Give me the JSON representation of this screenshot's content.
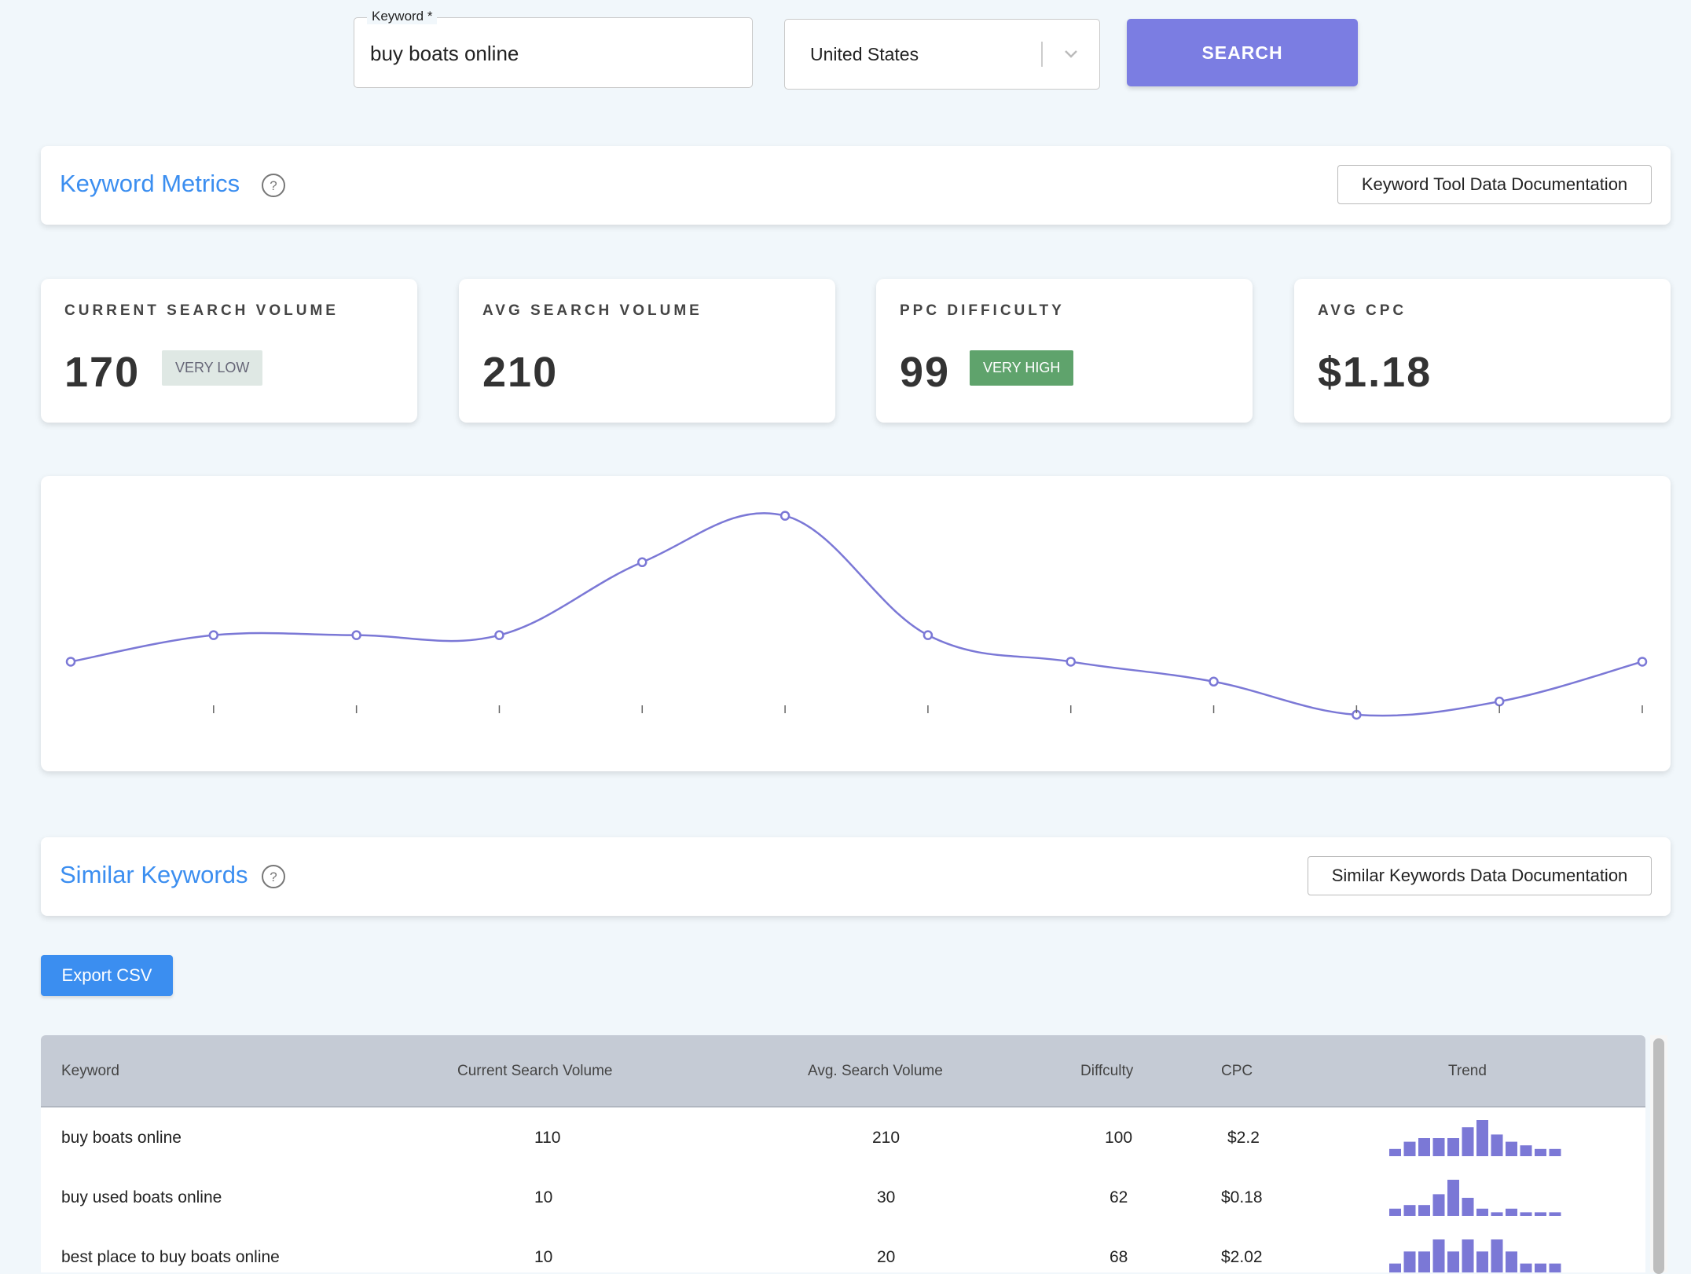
{
  "search": {
    "keyword_label": "Keyword *",
    "keyword_value": "buy boats online",
    "country_value": "United States",
    "search_label": "SEARCH"
  },
  "metrics_section": {
    "title": "Keyword Metrics",
    "doc_button": "Keyword Tool Data Documentation"
  },
  "metrics": [
    {
      "label": "CURRENT SEARCH VOLUME",
      "value": "170",
      "badge": "VERY LOW"
    },
    {
      "label": "AVG SEARCH VOLUME",
      "value": "210",
      "badge": ""
    },
    {
      "label": "PPC DIFFICULTY",
      "value": "99",
      "badge": "VERY HIGH"
    },
    {
      "label": "AVG CPC",
      "value": "$1.18",
      "badge": ""
    }
  ],
  "colors": {
    "accent": "#3b8ef0",
    "search_button": "#7b7de2",
    "line": "#7b78d6",
    "badge_low_bg": "#dfe8e4",
    "badge_low_text": "#667",
    "badge_high_bg": "#5fa36c"
  },
  "chart_data": {
    "type": "line",
    "values": [
      170,
      210,
      210,
      210,
      320,
      390,
      210,
      170,
      140,
      90,
      110,
      170
    ],
    "grid": false,
    "title": "",
    "xlabel": "",
    "ylabel": ""
  },
  "similar_section": {
    "title": "Similar Keywords",
    "doc_button": "Similar Keywords Data Documentation",
    "export_label": "Export CSV"
  },
  "table": {
    "headers": [
      "Keyword",
      "Current Search Volume",
      "Avg. Search Volume",
      "Diffculty",
      "CPC",
      "Trend"
    ],
    "rows": [
      {
        "keyword": "buy boats online",
        "current": "110",
        "avg": "210",
        "difficulty": "100",
        "cpc": "$2.2",
        "trend": [
          2,
          4,
          5,
          5,
          5,
          8,
          10,
          6,
          4,
          3,
          2,
          2
        ]
      },
      {
        "keyword": "buy used boats online",
        "current": "10",
        "avg": "30",
        "difficulty": "62",
        "cpc": "$0.18",
        "trend": [
          2,
          3,
          3,
          6,
          10,
          5,
          2,
          1,
          2,
          1,
          1,
          1
        ]
      },
      {
        "keyword": "best place to buy boats online",
        "current": "10",
        "avg": "20",
        "difficulty": "68",
        "cpc": "$2.02",
        "trend": [
          2,
          4,
          4,
          6,
          4,
          6,
          4,
          6,
          4,
          2,
          2,
          2
        ]
      }
    ]
  }
}
